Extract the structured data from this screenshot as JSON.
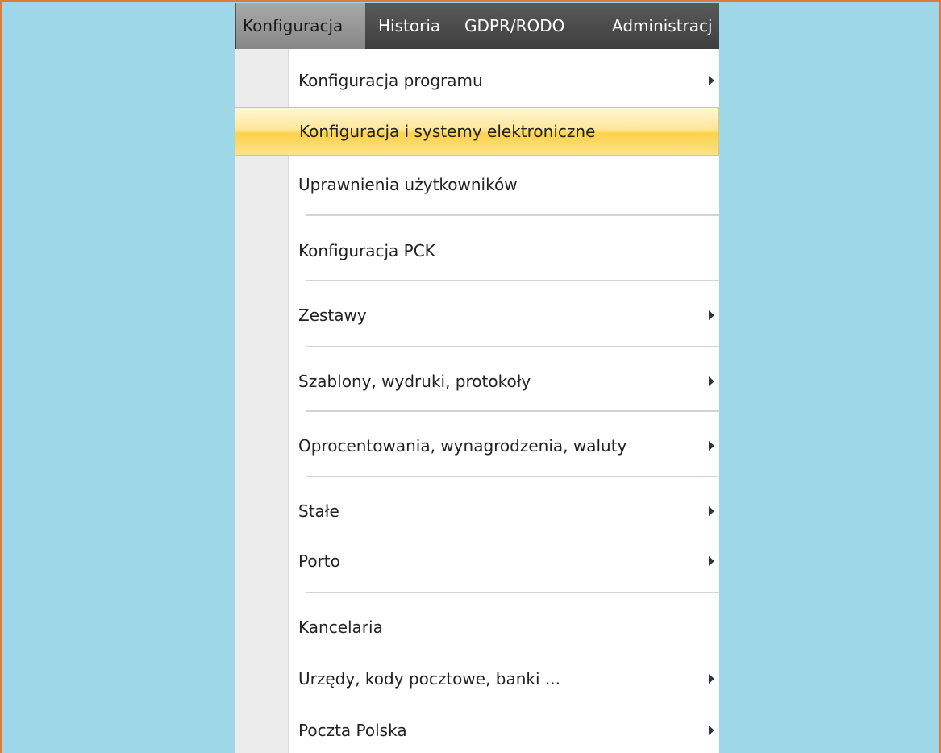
{
  "menubar": {
    "items": [
      {
        "label": "Konfiguracja",
        "active": true
      },
      {
        "label": "Historia",
        "active": false
      },
      {
        "label": "GDPR/RODO",
        "active": false
      },
      {
        "label": "Administracj",
        "active": false
      }
    ]
  },
  "dropdown": {
    "items": [
      {
        "label": "Konfiguracja programu",
        "submenu": true,
        "highlighted": false
      },
      {
        "label": "Konfiguracja i systemy elektroniczne",
        "submenu": false,
        "highlighted": true
      },
      {
        "label": "Uprawnienia użytkowników",
        "submenu": false,
        "highlighted": false
      },
      {
        "label": "Konfiguracja PCK",
        "submenu": false,
        "highlighted": false
      },
      {
        "label": "Zestawy",
        "submenu": true,
        "highlighted": false
      },
      {
        "label": "Szablony, wydruki, protokoły",
        "submenu": true,
        "highlighted": false
      },
      {
        "label": "Oprocentowania, wynagrodzenia, waluty",
        "submenu": true,
        "highlighted": false
      },
      {
        "label": "Stałe",
        "submenu": true,
        "highlighted": false
      },
      {
        "label": "Porto",
        "submenu": true,
        "highlighted": false
      },
      {
        "label": "Kancelaria",
        "submenu": false,
        "highlighted": false
      },
      {
        "label": "Urzędy, kody pocztowe, banki ...",
        "submenu": true,
        "highlighted": false
      },
      {
        "label": "Poczta Polska",
        "submenu": true,
        "highlighted": false
      }
    ]
  },
  "colors": {
    "background": "#9ed8e8",
    "frame_border": "#e07a3a",
    "menubar": "#4a4a4a",
    "highlight": "#fcd24a"
  }
}
